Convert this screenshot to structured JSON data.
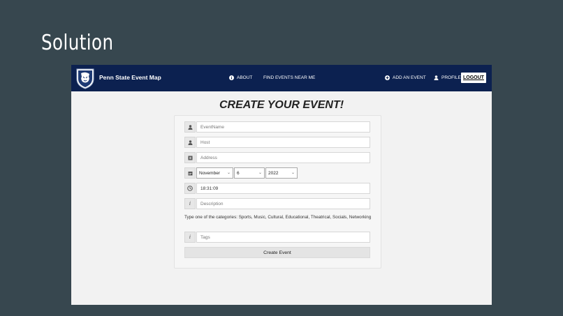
{
  "slide": {
    "title": "Solution"
  },
  "nav": {
    "brand": "Penn State Event Map",
    "about": "ABOUT",
    "find": "FIND EVENTS NEAR ME",
    "add": "ADD AN EVENT",
    "profile": "PROFILE",
    "logout": "LOGOUT"
  },
  "form": {
    "heading": "CREATE YOUR EVENT!",
    "event_name_placeholder": "EventName",
    "host_placeholder": "Host",
    "address_placeholder": "Address",
    "month": "November",
    "day": "6",
    "year": "2022",
    "time": "18:31:09",
    "description_placeholder": "Description",
    "categories_hint": "Type one of the categories: Sports, Music, Cultural, Educational, Theatrical, Socials, Networking",
    "tags_placeholder": "Tags",
    "submit": "Create Event"
  },
  "icons": {
    "event_name": "person-icon",
    "host": "person-icon",
    "address": "address-card-icon",
    "date": "calendar-icon",
    "time": "clock-icon",
    "description": "info-icon",
    "tags": "info-icon"
  },
  "colors": {
    "navbar": "#0c2150",
    "slide_bg": "#37474f"
  }
}
